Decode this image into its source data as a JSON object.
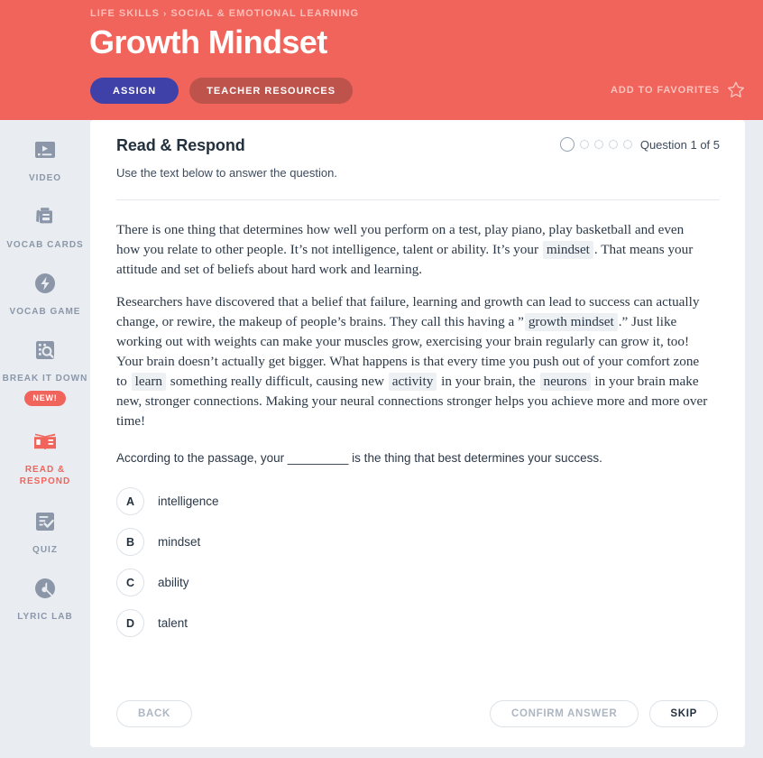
{
  "header": {
    "breadcrumb": {
      "parent": "LIFE SKILLS",
      "separator": "›",
      "child": "SOCIAL & EMOTIONAL LEARNING"
    },
    "title": "Growth Mindset",
    "assign_label": "ASSIGN",
    "teacher_resources_label": "TEACHER RESOURCES",
    "favorites_label": "ADD TO FAVORITES",
    "favorites_icon": "star-outline-icon",
    "bg_color": "#f0645b",
    "assign_color": "#3f41a8",
    "teacher_color": "#be534b"
  },
  "sidebar": {
    "bg_color": "#e9edf1",
    "inactive_color": "#8b97a8",
    "active_color": "#f0645b",
    "items": [
      {
        "label": "VIDEO",
        "icon": "video-icon",
        "active": false
      },
      {
        "label": "VOCAB CARDS",
        "icon": "vocab-cards-icon",
        "active": false
      },
      {
        "label": "VOCAB GAME",
        "icon": "vocab-game-bolt-icon",
        "active": false
      },
      {
        "label": "BREAK IT DOWN",
        "icon": "break-it-down-magnifier-icon",
        "active": false,
        "badge": "NEW!"
      },
      {
        "label": "READ & RESPOND",
        "icon": "open-book-icon",
        "active": true
      },
      {
        "label": "QUIZ",
        "icon": "quiz-checklist-icon",
        "active": false
      },
      {
        "label": "LYRIC LAB",
        "icon": "lyric-lab-note-icon",
        "active": false
      }
    ]
  },
  "card": {
    "title": "Read & Respond",
    "subtitle": "Use the text below to answer the question.",
    "progress": {
      "label": "Question 1 of 5",
      "current": 1,
      "total": 5
    },
    "passage": {
      "paragraph1": [
        {
          "t": "There is one thing that determines how well you perform on a test, play piano, play basketball and even how you relate to other people. It’s not intelligence, talent or ability. It’s your "
        },
        {
          "t": "mindset",
          "hl": true
        },
        {
          "t": ". That means your attitude and set of beliefs about hard work and learning."
        }
      ],
      "paragraph2": [
        {
          "t": "Researchers have discovered that a belief that failure, learning and growth can lead to success can actually change, or rewire, the makeup of people’s brains. They call this having a ”"
        },
        {
          "t": "growth mindset",
          "hl": true
        },
        {
          "t": ".” Just like working out with weights can make your muscles grow, exercising your brain regularly can grow it, too! Your brain doesn’t actually get bigger. What happens is that every time you push out of your comfort zone to "
        },
        {
          "t": "learn",
          "hl": true
        },
        {
          "t": " something really difficult, causing new "
        },
        {
          "t": "activity",
          "hl": true
        },
        {
          "t": " in your brain, the "
        },
        {
          "t": "neurons",
          "hl": true
        },
        {
          "t": " in your brain make new, stronger connections. Making your neural connections stronger helps you achieve more and more over time!"
        }
      ]
    },
    "question": "According to the passage, your _________ is the thing that best determines your success.",
    "choices": [
      {
        "letter": "A",
        "text": "intelligence"
      },
      {
        "letter": "B",
        "text": "mindset"
      },
      {
        "letter": "C",
        "text": "ability"
      },
      {
        "letter": "D",
        "text": "talent"
      }
    ],
    "footer": {
      "back_label": "BACK",
      "confirm_label": "CONFIRM ANSWER",
      "skip_label": "SKIP",
      "back_disabled": true,
      "confirm_disabled": true,
      "skip_disabled": false
    }
  }
}
